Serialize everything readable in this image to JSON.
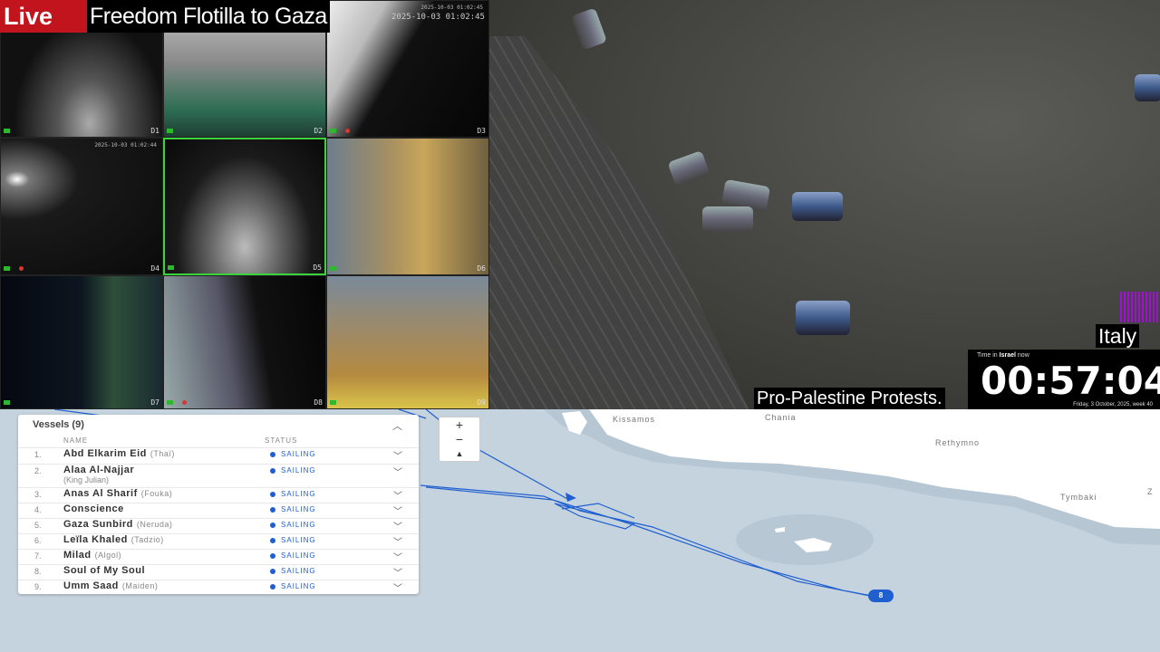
{
  "live_badge": "Live",
  "stream_title": "Freedom Flotilla to Gaza",
  "cams": [
    {
      "label": "D1",
      "timestamp": ""
    },
    {
      "label": "D2",
      "timestamp": ""
    },
    {
      "label": "D3",
      "timestamp": "2025-10-03 01:02:45"
    },
    {
      "label": "D4",
      "timestamp": "2025-10-03 01:02:44"
    },
    {
      "label": "D5",
      "timestamp": ""
    },
    {
      "label": "D6",
      "timestamp": ""
    },
    {
      "label": "D7",
      "timestamp": ""
    },
    {
      "label": "D8",
      "timestamp": ""
    },
    {
      "label": "D9",
      "timestamp": ""
    }
  ],
  "right_feed": {
    "caption": "Pro-Palestine Protests.",
    "country": "Italy"
  },
  "clock": {
    "caption_prefix": "Time in",
    "caption_place": "Israel",
    "caption_suffix": "now",
    "time": "00:57:04",
    "date": "Friday, 3 October, 2025, week 40"
  },
  "map": {
    "places": [
      "Kissamos",
      "Chania",
      "Rethymno",
      "Tymbaki",
      "Z"
    ],
    "zoom_in": "+",
    "zoom_out": "−",
    "compass": "▲",
    "marker_label": "8"
  },
  "vessels": {
    "title": "Vessels (9)",
    "col_name": "NAME",
    "col_status": "STATUS",
    "items": [
      {
        "num": "1.",
        "name": "Abd Elkarim Eid",
        "alias": "(Thaï)",
        "status": "SAILING"
      },
      {
        "num": "2.",
        "name": "Alaa Al-Najjar",
        "alias": "(King Julian)",
        "status": "SAILING"
      },
      {
        "num": "3.",
        "name": "Anas Al Sharif",
        "alias": "(Fouka)",
        "status": "SAILING"
      },
      {
        "num": "4.",
        "name": "Conscience",
        "alias": "",
        "status": "SAILING"
      },
      {
        "num": "5.",
        "name": "Gaza Sunbird",
        "alias": "(Neruda)",
        "status": "SAILING"
      },
      {
        "num": "6.",
        "name": "Leïla Khaled",
        "alias": "(Tadzio)",
        "status": "SAILING"
      },
      {
        "num": "7.",
        "name": "Milad",
        "alias": "(Algol)",
        "status": "SAILING"
      },
      {
        "num": "8.",
        "name": "Soul of My Soul",
        "alias": "",
        "status": "SAILING"
      },
      {
        "num": "9.",
        "name": "Umm Saad",
        "alias": "(Maiden)",
        "status": "SAILING"
      }
    ]
  }
}
